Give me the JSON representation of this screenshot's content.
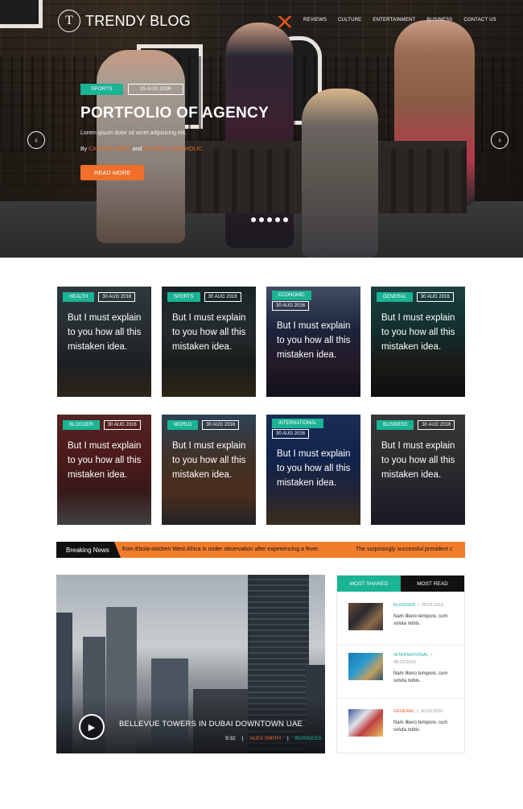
{
  "brand": {
    "logo_letter": "T",
    "name": "TRENDY BLOG"
  },
  "nav": {
    "items": [
      "Reviews",
      "Culture",
      "Entertainment",
      "Business",
      "Contact us"
    ]
  },
  "hero": {
    "tag": "SPORTS",
    "date": "15 AUG 2016",
    "title": "PORTFOLIO OF AGENCY",
    "text": "Lorem ipsum dolor sit amet adipisicing elit.",
    "by_prefix": "By",
    "author1": "CAPTAIN FROM",
    "and": "and",
    "author2": "MICHEAL CARTHOLIC",
    "read_more": "READ MORE",
    "slider_dots": 5,
    "colors": {
      "tag": "#1ab394",
      "button": "#f06f2a"
    }
  },
  "cards": [
    {
      "tag": "HEALTH",
      "date": "30 AUG 2016",
      "title": "But I must explain to you how all this mistaken idea."
    },
    {
      "tag": "SPORTS",
      "date": "30 AUG 2016",
      "title": "But I must explain to you how all this mistaken idea."
    },
    {
      "tag": "ECONOMIC",
      "date": "30 AUG 2016",
      "title": "But I must explain to you how all this mistaken idea."
    },
    {
      "tag": "GENERAL",
      "date": "30 AUG 2016",
      "title": "But I must explain to you how all this mistaken idea."
    },
    {
      "tag": "BLOGGER",
      "date": "30 AUG 2016",
      "title": "But I must explain to you how all this mistaken idea."
    },
    {
      "tag": "WORLD",
      "date": "30 AUG 2016",
      "title": "But I must explain to you how all this mistaken idea."
    },
    {
      "tag": "INTERNATIONAL",
      "date": "30 AUG 2016",
      "title": "But I must explain to you how all this mistaken idea."
    },
    {
      "tag": "BUSINESS",
      "date": "30 AUG 2016",
      "title": "But I must explain to you how all this mistaken idea."
    }
  ],
  "breaking": {
    "label": "Breaking News",
    "text1": "from Ebola-stricken West Africa is under observation after experiencing a fever.",
    "text2": "The surprisingly successful president c",
    "color": "#f27c2c"
  },
  "feature": {
    "title": "BELLEVUE TOWERS IN DUBAI DOWNTOWN UAE",
    "time": "9:32",
    "author": "ALEX SMITH",
    "category": "BUSINESS"
  },
  "sidebar": {
    "tabs": [
      "MOST SHARED",
      "MOST READ"
    ],
    "items": [
      {
        "category": "BLOGGER",
        "date": "30.03.2016",
        "desc": "Nam libero tempore, cum soluta nobis.",
        "cat_color": "#1ab394"
      },
      {
        "category": "INTERNATIONAL",
        "date": "30.03.2016",
        "desc": "Nam libero tempore, cum soluta nobis.",
        "cat_color": "#1ab394"
      },
      {
        "category": "GENERAL",
        "date": "30.03.2016",
        "desc": "Nam libero tempore, cum soluta nobis.",
        "cat_color": "#e8632a"
      }
    ]
  }
}
